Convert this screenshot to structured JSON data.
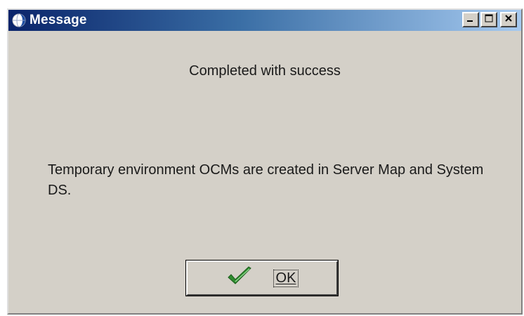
{
  "window": {
    "title": "Message",
    "title_icon": "globe-icon",
    "controls": {
      "minimize_icon": "minimize-icon",
      "restore_icon": "restore-icon",
      "close_icon": "close-icon"
    }
  },
  "message": {
    "heading": "Completed with success",
    "body": "Temporary environment OCMs are created in Server Map and System DS."
  },
  "ok_button": {
    "label": "OK",
    "icon": "checkmark-icon"
  },
  "colors": {
    "title_gradient_start": "#0a246a",
    "title_gradient_end": "#a6caf0",
    "window_face": "#d4d0c8",
    "checkmark": "#2e8b2e"
  }
}
